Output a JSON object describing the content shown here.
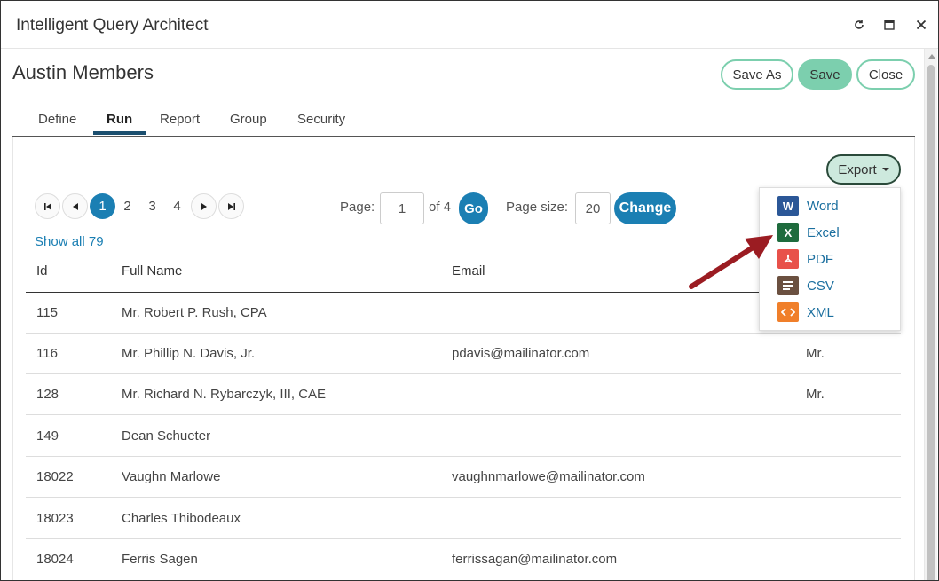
{
  "window": {
    "title": "Intelligent Query Architect"
  },
  "header": {
    "title": "Austin Members",
    "save_as_label": "Save As",
    "save_label": "Save",
    "close_label": "Close"
  },
  "tabs": [
    {
      "label": "Define"
    },
    {
      "label": "Run",
      "active": true
    },
    {
      "label": "Report"
    },
    {
      "label": "Group"
    },
    {
      "label": "Security"
    }
  ],
  "export": {
    "label": "Export",
    "menu": [
      {
        "label": "Word",
        "icon": "word-icon",
        "color": "#2b5797",
        "glyph": "W"
      },
      {
        "label": "Excel",
        "icon": "excel-icon",
        "color": "#1e6b3d",
        "glyph": "X"
      },
      {
        "label": "PDF",
        "icon": "pdf-icon",
        "color": "#e8514a",
        "glyph": "⅄"
      },
      {
        "label": "CSV",
        "icon": "csv-icon",
        "color": "#6b5040",
        "glyph": "≡"
      },
      {
        "label": "XML",
        "icon": "xml-icon",
        "color": "#f07f2a",
        "glyph": "‹›"
      }
    ]
  },
  "pager": {
    "pages": [
      "1",
      "2",
      "3",
      "4"
    ],
    "current_page": "1",
    "page_label": "Page:",
    "page_value": "1",
    "of_label": "of 4",
    "go_label": "Go",
    "page_size_label": "Page size:",
    "page_size_value": "20",
    "change_label": "Change",
    "show_all_label": "Show all 79"
  },
  "table": {
    "columns": [
      "Id",
      "Full Name",
      "Email"
    ],
    "rows": [
      {
        "id": "115",
        "name": "Mr. Robert P. Rush, CPA",
        "email": "",
        "prefix": ""
      },
      {
        "id": "116",
        "name": "Mr. Phillip N. Davis, Jr.",
        "email": "pdavis@mailinator.com",
        "prefix": "Mr."
      },
      {
        "id": "128",
        "name": "Mr. Richard N. Rybarczyk, III, CAE",
        "email": "",
        "prefix": "Mr."
      },
      {
        "id": "149",
        "name": "Dean Schueter",
        "email": "",
        "prefix": ""
      },
      {
        "id": "18022",
        "name": "Vaughn Marlowe",
        "email": "vaughnmarlowe@mailinator.com",
        "prefix": ""
      },
      {
        "id": "18023",
        "name": "Charles Thibodeaux",
        "email": "",
        "prefix": ""
      },
      {
        "id": "18024",
        "name": "Ferris Sagen",
        "email": "ferrissagan@mailinator.com",
        "prefix": ""
      }
    ]
  },
  "colors": {
    "accent": "#1b7fb3",
    "save_green": "#7ccfae",
    "annotation_arrow": "#9b1c22"
  }
}
